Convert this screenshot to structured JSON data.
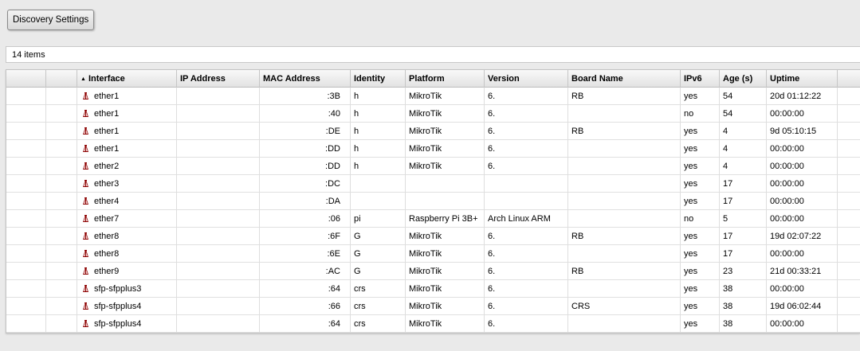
{
  "toolbar": {
    "discovery_settings_label": "Discovery Settings"
  },
  "status": {
    "item_count": "14 items"
  },
  "table": {
    "columns": {
      "interface": "Interface",
      "ip_address": "IP Address",
      "mac_address": "MAC Address",
      "identity": "Identity",
      "platform": "Platform",
      "version": "Version",
      "board_name": "Board Name",
      "ipv6": "IPv6",
      "age": "Age (s)",
      "uptime": "Uptime"
    },
    "sort_indicator": "▲",
    "interface_icon": "interface-icon",
    "rows": [
      {
        "interface": "ether1",
        "ip": "",
        "mac": ":3B",
        "identity": "h",
        "platform": "MikroTik",
        "version": "6.",
        "board": "RB",
        "ipv6": "yes",
        "age": "54",
        "uptime": "20d 01:12:22"
      },
      {
        "interface": "ether1",
        "ip": "",
        "mac": ":40",
        "identity": "h",
        "platform": "MikroTik",
        "version": "6.",
        "board": "",
        "ipv6": "no",
        "age": "54",
        "uptime": "00:00:00"
      },
      {
        "interface": "ether1",
        "ip": "",
        "mac": ":DE",
        "identity": "h",
        "platform": "MikroTik",
        "version": "6.",
        "board": "RB",
        "ipv6": "yes",
        "age": "4",
        "uptime": "9d 05:10:15"
      },
      {
        "interface": "ether1",
        "ip": "",
        "mac": ":DD",
        "identity": "h",
        "platform": "MikroTik",
        "version": "6.",
        "board": "",
        "ipv6": "yes",
        "age": "4",
        "uptime": "00:00:00"
      },
      {
        "interface": "ether2",
        "ip": "",
        "mac": ":DD",
        "identity": "h",
        "platform": "MikroTik",
        "version": "6.",
        "board": "",
        "ipv6": "yes",
        "age": "4",
        "uptime": "00:00:00"
      },
      {
        "interface": "ether3",
        "ip": "",
        "mac": ":DC",
        "identity": "",
        "platform": "",
        "version": "",
        "board": "",
        "ipv6": "yes",
        "age": "17",
        "uptime": "00:00:00"
      },
      {
        "interface": "ether4",
        "ip": "",
        "mac": ":DA",
        "identity": "",
        "platform": "",
        "version": "",
        "board": "",
        "ipv6": "yes",
        "age": "17",
        "uptime": "00:00:00"
      },
      {
        "interface": "ether7",
        "ip": "",
        "mac": ":06",
        "identity": "pi",
        "platform": "Raspberry Pi 3B+",
        "version": "Arch Linux ARM",
        "board": "",
        "ipv6": "no",
        "age": "5",
        "uptime": "00:00:00"
      },
      {
        "interface": "ether8",
        "ip": "",
        "mac": ":6F",
        "identity": "G",
        "platform": "MikroTik",
        "version": "6.",
        "board": "RB",
        "ipv6": "yes",
        "age": "17",
        "uptime": "19d 02:07:22"
      },
      {
        "interface": "ether8",
        "ip": "",
        "mac": ":6E",
        "identity": "G",
        "platform": "MikroTik",
        "version": "6.",
        "board": "",
        "ipv6": "yes",
        "age": "17",
        "uptime": "00:00:00"
      },
      {
        "interface": "ether9",
        "ip": "",
        "mac": ":AC",
        "identity": "G",
        "platform": "MikroTik",
        "version": "6.",
        "board": "RB",
        "ipv6": "yes",
        "age": "23",
        "uptime": "21d 00:33:21"
      },
      {
        "interface": "sfp-sfpplus3",
        "ip": "",
        "mac": ":64",
        "identity": "crs",
        "platform": "MikroTik",
        "version": "6.",
        "board": "",
        "ipv6": "yes",
        "age": "38",
        "uptime": "00:00:00"
      },
      {
        "interface": "sfp-sfpplus4",
        "ip": "",
        "mac": ":66",
        "identity": "crs",
        "platform": "MikroTik",
        "version": "6.",
        "board": "CRS",
        "ipv6": "yes",
        "age": "38",
        "uptime": "19d 06:02:44"
      },
      {
        "interface": "sfp-sfpplus4",
        "ip": "",
        "mac": ":64",
        "identity": "crs",
        "platform": "MikroTik",
        "version": "6.",
        "board": "",
        "ipv6": "yes",
        "age": "38",
        "uptime": "00:00:00"
      }
    ]
  },
  "colors": {
    "icon_red": "#8b0000",
    "icon_light": "#f4d6d6"
  }
}
